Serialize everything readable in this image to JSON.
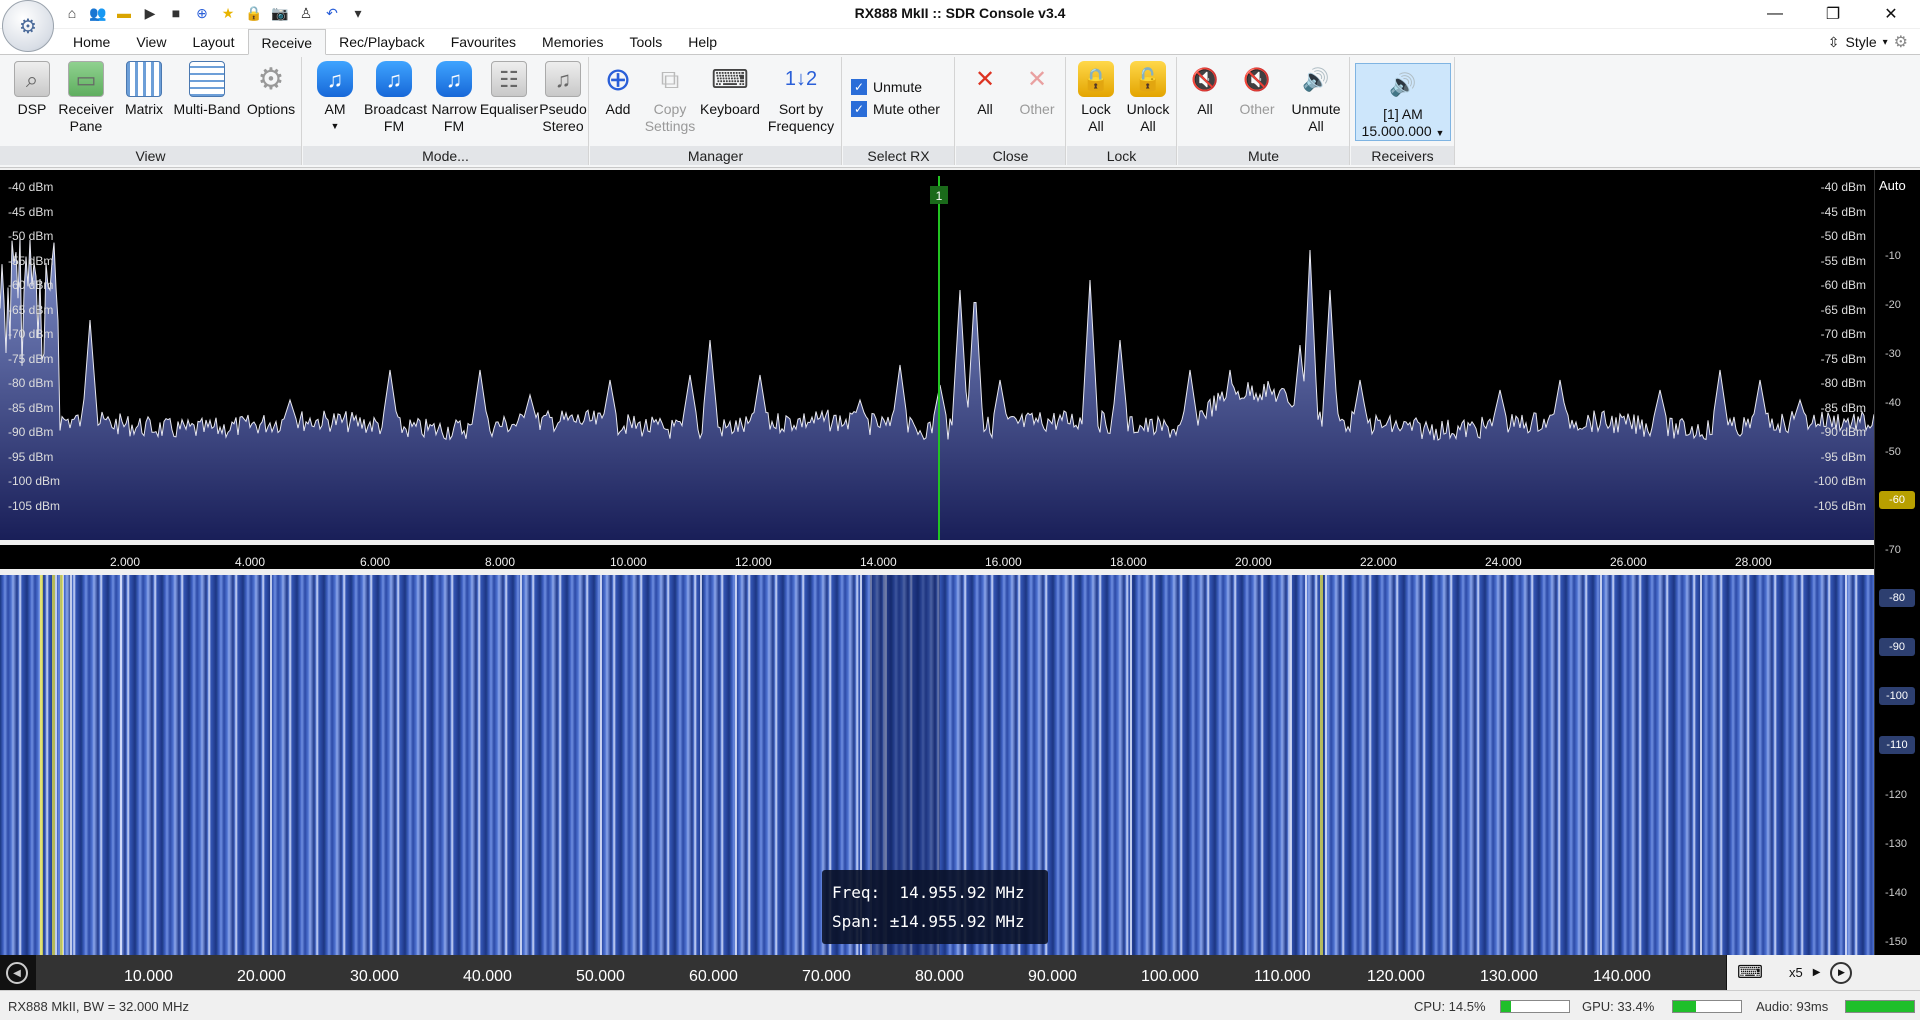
{
  "window": {
    "title": "RX888 MkII :: SDR Console v3.4",
    "minimize": "—",
    "restore": "❐",
    "close": "✕"
  },
  "qat": [
    "home-icon",
    "users-icon",
    "folder-icon",
    "play-icon",
    "stop-icon",
    "plus-circle-icon",
    "star-icon",
    "lock-icon",
    "camera-icon",
    "person-icon",
    "undo-icon",
    "dropdown-icon"
  ],
  "tabs": [
    "Home",
    "View",
    "Layout",
    "Receive",
    "Rec/Playback",
    "Favourites",
    "Memories",
    "Tools",
    "Help"
  ],
  "active_tab": "Receive",
  "style_label": "Style",
  "ribbon": {
    "view": {
      "label": "View",
      "buttons": [
        "DSP",
        "Receiver Pane",
        "Matrix",
        "Multi-Band",
        "Options"
      ]
    },
    "mode": {
      "label": "Mode...",
      "buttons": [
        "AM",
        "Broadcast FM",
        "Narrow FM",
        "Equaliser",
        "Pseudo Stereo"
      ]
    },
    "manager": {
      "label": "Manager",
      "buttons": [
        "Add",
        "Copy Settings",
        "Keyboard",
        "Sort by Frequency"
      ]
    },
    "select_rx": {
      "label": "Select RX",
      "unmute": "Unmute",
      "mute_other": "Mute other"
    },
    "close": {
      "label": "Close",
      "buttons": [
        "All",
        "Other"
      ]
    },
    "lock": {
      "label": "Lock",
      "buttons": [
        "Lock All",
        "Unlock All"
      ]
    },
    "mute": {
      "label": "Mute",
      "buttons": [
        "All",
        "Other",
        "Unmute All"
      ]
    },
    "receivers": {
      "label": "Receivers",
      "rx_line1": "[1]  AM",
      "rx_line2": "15.000.000"
    }
  },
  "spectrum": {
    "marker_label": "1",
    "dbm_labels": [
      "-40 dBm",
      "-45 dBm",
      "-50 dBm",
      "-55 dBm",
      "-60 dBm",
      "-65 dBm",
      "-70 dBm",
      "-75 dBm",
      "-80 dBm",
      "-85 dBm",
      "-90 dBm",
      "-95 dBm",
      "-100 dBm",
      "-105 dBm"
    ],
    "freq_labels": [
      "2.000",
      "4.000",
      "6.000",
      "8.000",
      "10.000",
      "12.000",
      "14.000",
      "16.000",
      "18.000",
      "20.000",
      "22.000",
      "24.000",
      "26.000",
      "28.000"
    ]
  },
  "scale_panel": {
    "auto": "Auto",
    "ticks": [
      "-10",
      "-20",
      "-30",
      "-40",
      "-50",
      "-60",
      "-70",
      "-80",
      "-90",
      "-100",
      "-110",
      "-120",
      "-130",
      "-140",
      "-150"
    ]
  },
  "tooltip": {
    "freq_line": "Freq:  14.955.92 MHz",
    "span_line": "Span: ±14.955.92 MHz"
  },
  "overview": {
    "labels": [
      "10.000",
      "20.000",
      "30.000",
      "40.000",
      "50.000",
      "60.000",
      "70.000",
      "80.000",
      "90.000",
      "100.000",
      "110.000",
      "120.000",
      "130.000",
      "140.000"
    ],
    "zoom": "x5"
  },
  "status": {
    "left": "RX888 MkII, BW = 32.000 MHz",
    "cpu": "CPU: 14.5%",
    "cpu_level": 0.145,
    "gpu": "GPU: 33.4%",
    "gpu_level": 0.334,
    "audio": "Audio: 93ms",
    "audio_level": 1.0
  }
}
